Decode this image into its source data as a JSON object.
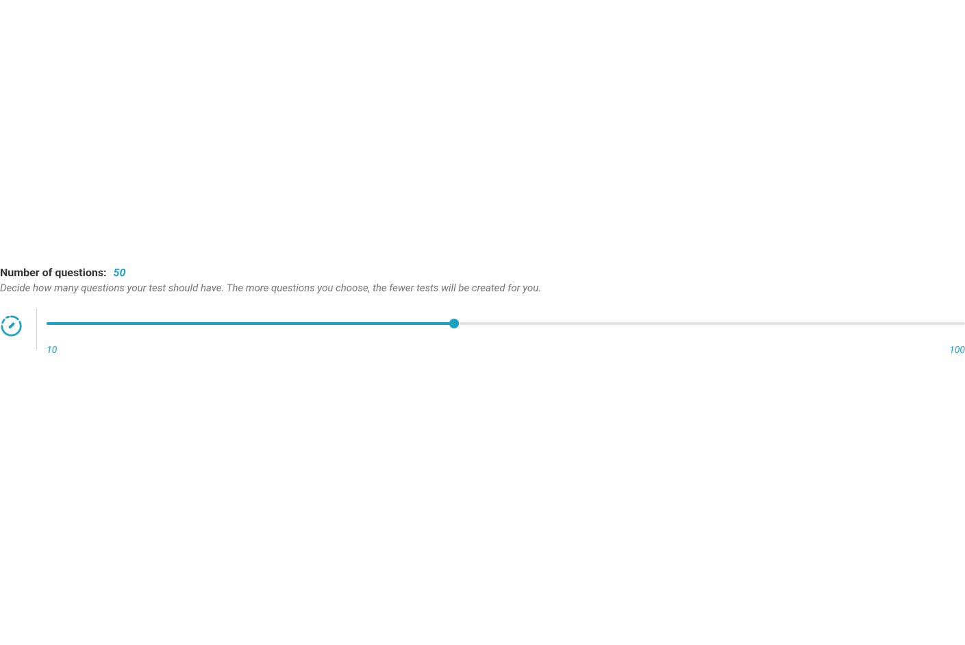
{
  "header": {
    "title": "Number of questions:",
    "value": "50",
    "description": "Decide how many questions your test should have. The more questions you choose, the fewer tests will be created for you."
  },
  "slider": {
    "min": 10,
    "max": 100,
    "current": 50,
    "min_label": "10",
    "max_label": "100",
    "fill_percent": "44.4%",
    "icon_name": "edit-dashed-circle-icon",
    "accent_color": "#1ba3c1"
  }
}
